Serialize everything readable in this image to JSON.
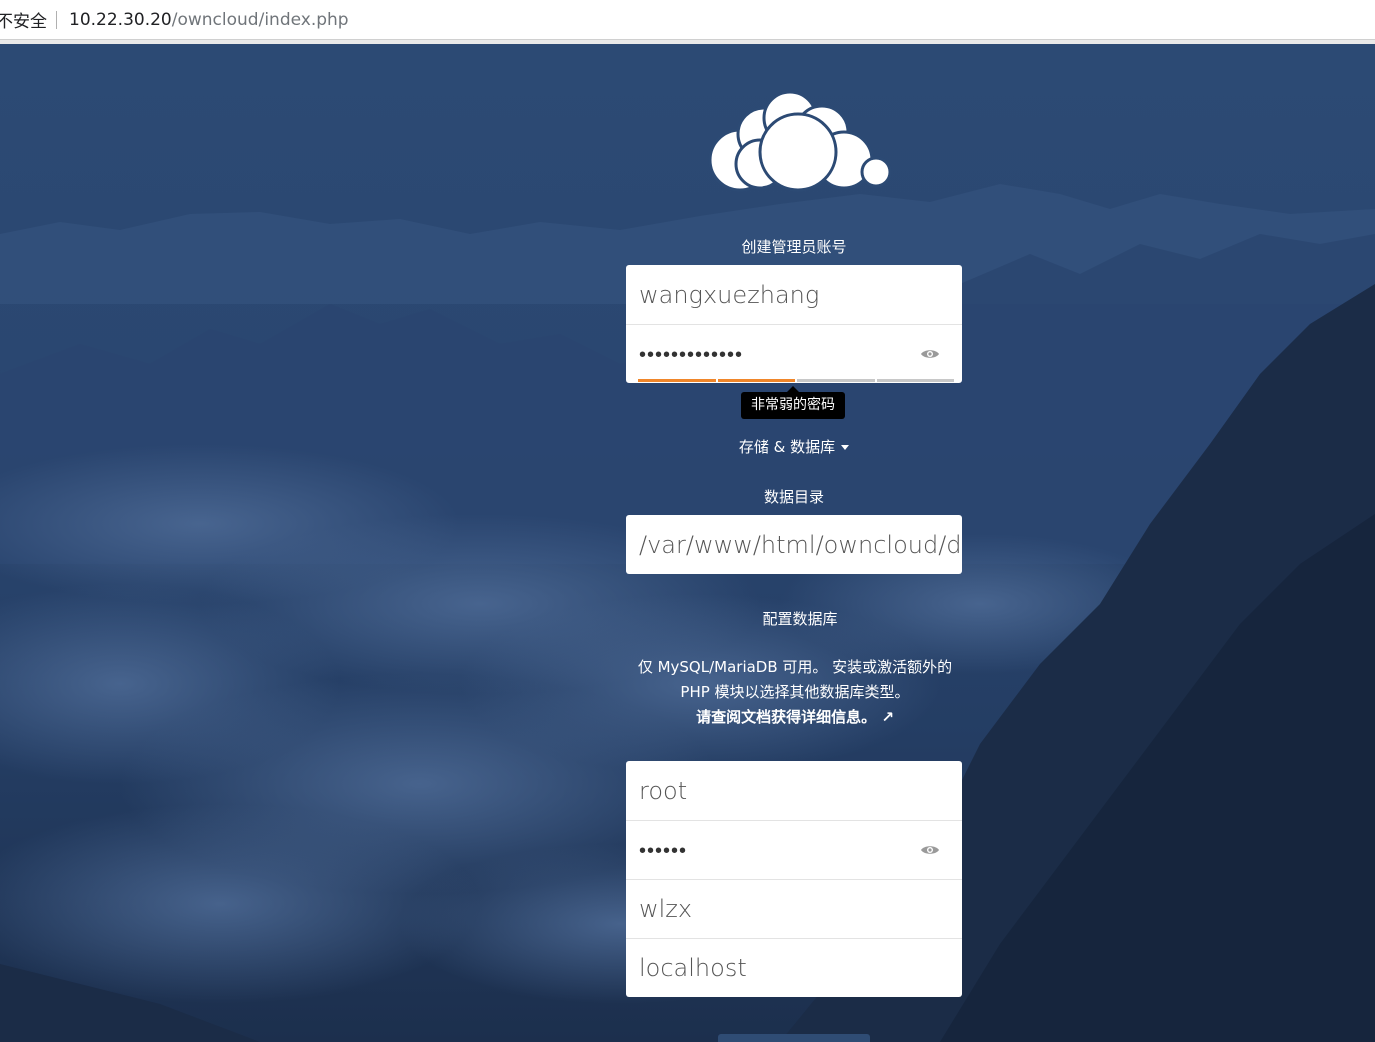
{
  "browser": {
    "security_label": "不安全",
    "url_host": "10.22.30.20",
    "url_path": "/owncloud/index.php"
  },
  "admin": {
    "title": "创建管理员账号",
    "username_value": "wangxuezhang",
    "password_dots": "•••••••••••••",
    "password_strength_level": 0.5,
    "strength_tooltip": "非常弱的密码"
  },
  "storage": {
    "toggle_label": "存储 & 数据库",
    "data_dir_label": "数据目录",
    "data_dir_value": "/var/www/html/owncloud/data"
  },
  "database": {
    "title": "配置数据库",
    "info_line1": "仅 MySQL/MariaDB 可用。 安装或激活额外的",
    "info_line2": "PHP 模块以选择其他数据库类型。",
    "docs_link": "请查阅文档获得详细信息。 ↗",
    "user_value": "root",
    "password_dots": "••••••",
    "name_value": "wlzx",
    "host_value": "localhost"
  },
  "colors": {
    "accent": "#f0862a",
    "background": "#2a4670"
  }
}
